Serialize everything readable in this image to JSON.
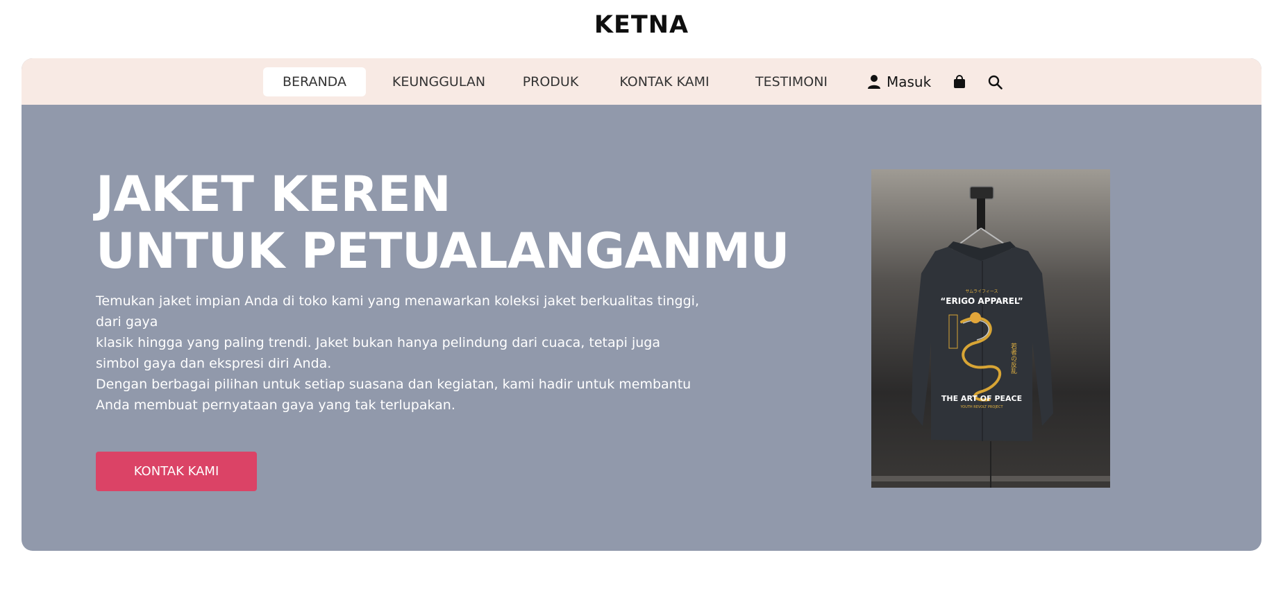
{
  "brand": {
    "name": "KETNA"
  },
  "nav": {
    "items": [
      {
        "label": "BERANDA",
        "active": true
      },
      {
        "label": "KEUNGGULAN",
        "active": false
      },
      {
        "label": "PRODUK",
        "active": false
      },
      {
        "label": "KONTAK KAMI",
        "active": false
      },
      {
        "label": "TESTIMONI",
        "active": false
      }
    ],
    "login_label": "Masuk",
    "icons": [
      "user-icon",
      "shopping-bag-icon",
      "search-icon"
    ]
  },
  "hero": {
    "headline": [
      "JAKET KEREN",
      "UNTUK PETUALANGANMU"
    ],
    "description": [
      "Temukan jaket impian Anda di toko kami yang menawarkan koleksi jaket berkualitas tinggi,",
      "dari gaya",
      "klasik hingga yang paling trendi. Jaket bukan hanya pelindung dari cuaca, tetapi juga",
      "simbol gaya dan ekspresi diri Anda.",
      "Dengan berbagai pilihan untuk setiap suasana dan kegiatan, kami hadir untuk membantu",
      "Anda membuat pernyataan gaya yang tak terlupakan."
    ],
    "cta_label": "KONTAK KAMI",
    "product_image": {
      "jacket_texts": [
        "サムライフィース",
        "“ERIGO APPAREL”",
        "THE ART OF PEACE",
        "YOUTH REVOLT PROJECT"
      ]
    }
  },
  "colors": {
    "navbar_bg": "#f8eae4",
    "hero_bg": "#9199ab",
    "cta_bg": "#db4366",
    "text_light": "#ffffff"
  }
}
